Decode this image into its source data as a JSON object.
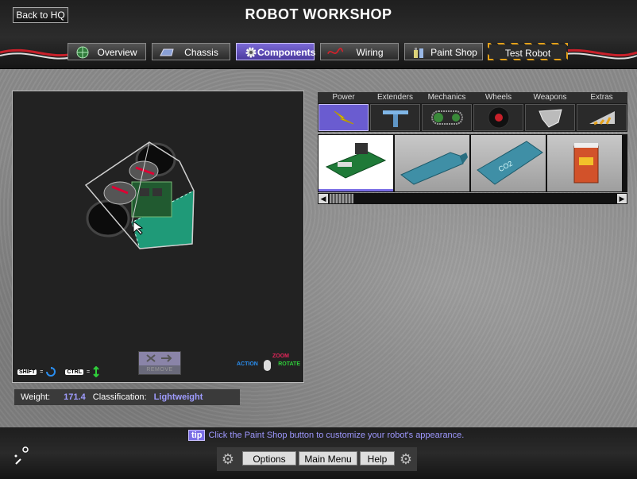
{
  "header": {
    "back_label": "Back to HQ",
    "title": "ROBOT WORKSHOP"
  },
  "tabs": [
    {
      "label": "Overview",
      "icon": "globe-icon",
      "active": false
    },
    {
      "label": "Chassis",
      "icon": "chassis-icon",
      "active": false
    },
    {
      "label": "Components",
      "icon": "gear-icon",
      "active": true
    },
    {
      "label": "Wiring",
      "icon": "wire-icon",
      "active": false
    },
    {
      "label": "Paint Shop",
      "icon": "paint-icon",
      "active": false
    },
    {
      "label": "Test Robot",
      "icon": "",
      "active": false
    }
  ],
  "viewport": {
    "hint_shift": "SHIFT",
    "hint_ctrl": "CTRL",
    "remove_label": "REMOVE",
    "zoom_label": "ZOOM",
    "action_label": "ACTION",
    "rotate_label": "ROTATE"
  },
  "stats": {
    "weight_label": "Weight:",
    "weight_value": "171.4",
    "class_label": "Classification:",
    "class_value": "Lightweight"
  },
  "categories": [
    {
      "label": "Power",
      "icon": "lightning-icon",
      "active": true
    },
    {
      "label": "Extenders",
      "icon": "extender-icon",
      "active": false
    },
    {
      "label": "Mechanics",
      "icon": "chain-icon",
      "active": false
    },
    {
      "label": "Wheels",
      "icon": "wheel-icon",
      "active": false
    },
    {
      "label": "Weapons",
      "icon": "blade-icon",
      "active": false
    },
    {
      "label": "Extras",
      "icon": "wedge-icon",
      "active": false
    }
  ],
  "parts": [
    {
      "icon": "circuit-board-icon",
      "selected": true
    },
    {
      "icon": "blue-tank-icon",
      "selected": false
    },
    {
      "icon": "co2-tank-icon",
      "selected": false
    },
    {
      "icon": "orange-battery-icon",
      "selected": false
    }
  ],
  "tip": {
    "badge": "tip",
    "text": "Click the Paint Shop button to customize your robot's appearance."
  },
  "footer": {
    "options_label": "Options",
    "main_menu_label": "Main Menu",
    "help_label": "Help"
  },
  "colors": {
    "accent": "#7a6ee6",
    "value_text": "#9f9cff",
    "warning_stripe": "#e6a21a"
  }
}
